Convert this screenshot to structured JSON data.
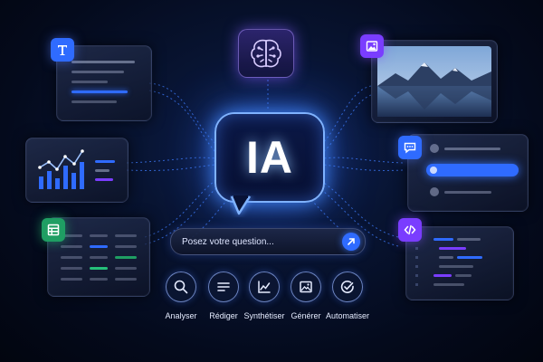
{
  "center": {
    "title": "IA"
  },
  "search": {
    "placeholder": "Posez votre question..."
  },
  "actions": [
    {
      "label": "Analyser",
      "icon": "magnifier-icon"
    },
    {
      "label": "Rédiger",
      "icon": "text-lines-icon"
    },
    {
      "label": "Synthétiser",
      "icon": "trend-chart-icon"
    },
    {
      "label": "Générer",
      "icon": "image-icon"
    },
    {
      "label": "Automatiser",
      "icon": "check-circle-icon"
    }
  ],
  "side_cards": [
    {
      "id": "text-document",
      "icon": "text-T-icon",
      "badge_color": "#2f6bff"
    },
    {
      "id": "analytics",
      "icon": "none"
    },
    {
      "id": "spreadsheet",
      "icon": "table-icon",
      "badge_color": "#1f9e63"
    },
    {
      "id": "image-preview",
      "icon": "image-icon",
      "badge_color": "#7a3dff"
    },
    {
      "id": "chat",
      "icon": "chat-bubble-icon",
      "badge_color": "#2f6bff"
    },
    {
      "id": "code",
      "icon": "code-brackets-icon",
      "badge_color": "#7a3dff"
    }
  ],
  "top_icon": "brain-circuit-icon",
  "colors": {
    "accent": "#2f6bff",
    "purple": "#7a3dff",
    "green": "#1f9e63",
    "background": "#040a1c"
  }
}
